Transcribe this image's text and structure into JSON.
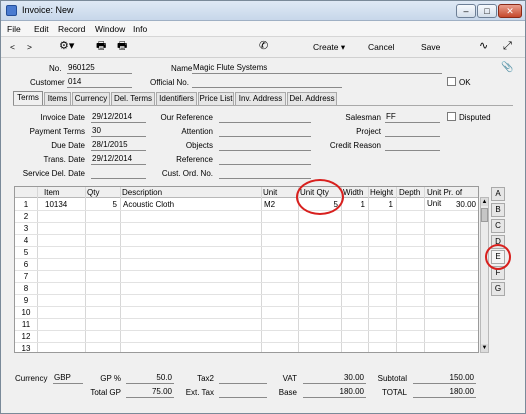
{
  "window": {
    "title": "Invoice: New",
    "controls": [
      "–",
      "□",
      "✕"
    ]
  },
  "menu": [
    "File",
    "Edit",
    "Record",
    "Window",
    "Info"
  ],
  "toolbar": {
    "nav_prev": "<",
    "nav_next": ">",
    "create_label": "Create",
    "cancel_label": "Cancel",
    "save_label": "Save"
  },
  "header": {
    "no_label": "No.",
    "no_value": "960125",
    "name_label": "Name",
    "name_value": "Magic Flute Systems",
    "customer_label": "Customer",
    "customer_value": "014",
    "official_no_label": "Official No.",
    "official_no_value": "",
    "ok_label": "OK"
  },
  "tabs": [
    "Terms",
    "Items",
    "Currency",
    "Del. Terms",
    "Identifiers",
    "Price List",
    "Inv. Address",
    "Del. Address"
  ],
  "terms": {
    "invoice_date_label": "Invoice Date",
    "invoice_date": "29/12/2014",
    "payment_terms_label": "Payment Terms",
    "payment_terms": "30",
    "due_date_label": "Due Date",
    "due_date": "28/1/2015",
    "trans_date_label": "Trans. Date",
    "trans_date": "29/12/2014",
    "service_del_date_label": "Service Del. Date",
    "service_del_date": "",
    "our_reference_label": "Our Reference",
    "our_reference": "",
    "attention_label": "Attention",
    "attention": "",
    "objects_label": "Objects",
    "objects": "",
    "reference_label": "Reference",
    "reference": "",
    "cust_ord_no_label": "Cust. Ord. No.",
    "cust_ord_no": "",
    "salesman_label": "Salesman",
    "salesman": "FF",
    "disputed_label": "Disputed",
    "project_label": "Project",
    "project": "",
    "credit_reason_label": "Credit Reason",
    "credit_reason": ""
  },
  "grid": {
    "columns": [
      "Item",
      "Qty",
      "Description",
      "Unit",
      "Unit Qty",
      "Width",
      "Height",
      "Depth",
      "Unit Pr. of Unit"
    ],
    "row_numbers": [
      "1",
      "2",
      "3",
      "4",
      "5",
      "6",
      "7",
      "8",
      "9",
      "10",
      "11",
      "12",
      "13"
    ],
    "rows": [
      {
        "item": "10134",
        "qty": "5",
        "description": "Acoustic Cloth",
        "unit": "M2",
        "unit_qty": "5",
        "width": "1",
        "height": "1",
        "depth": "",
        "unit_price": "30.00"
      }
    ]
  },
  "side_tabs": [
    "A",
    "B",
    "C",
    "D",
    "E",
    "F",
    "G"
  ],
  "footer": {
    "currency_label": "Currency",
    "currency": "GBP",
    "gp_pct_label": "GP %",
    "gp_pct": "50.0",
    "total_gp_label": "Total GP",
    "total_gp": "75.00",
    "tax2_label": "Tax2",
    "tax2": "",
    "ext_tax_label": "Ext. Tax",
    "ext_tax": "",
    "vat_label": "VAT",
    "vat": "30.00",
    "base_label": "Base",
    "base": "180.00",
    "subtotal_label": "Subtotal",
    "subtotal": "150.00",
    "total_label": "TOTAL",
    "total": "180.00"
  },
  "colors": {
    "highlight_circle": "#d8201e"
  }
}
